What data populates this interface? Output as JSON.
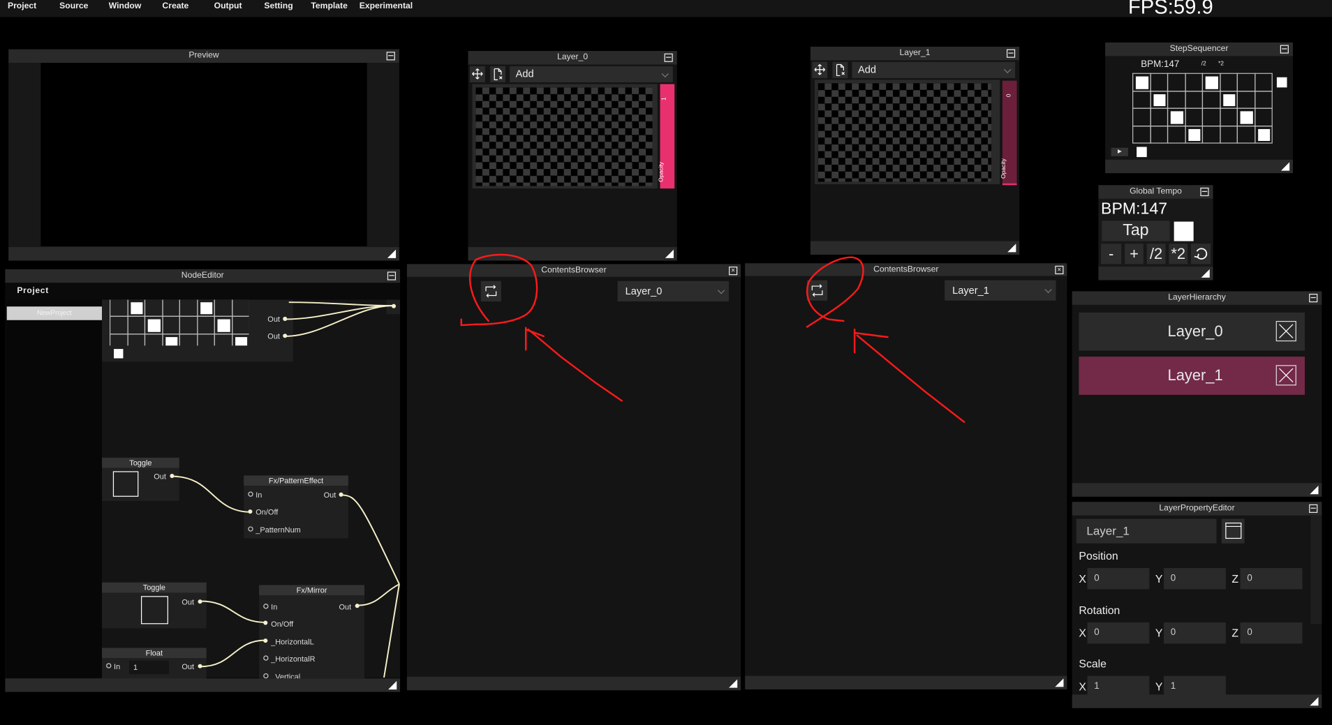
{
  "menu": [
    "Project",
    "Source",
    "Window",
    "Create",
    "Output",
    "Setting",
    "Template",
    "Experimental"
  ],
  "fps": "FPS:59.9",
  "preview": {
    "title": "Preview"
  },
  "layer_panels": [
    {
      "title": "Layer_0",
      "blend_mode": "Add",
      "opacity_label": "Opacity",
      "opacity_value": "1",
      "opacity": 1
    },
    {
      "title": "Layer_1",
      "blend_mode": "Add",
      "opacity_label": "Opacity",
      "opacity_value": "0",
      "opacity": 0
    }
  ],
  "step_sequencer": {
    "title": "StepSequencer",
    "bpm": "BPM:147",
    "half": "/2",
    "double": "*2",
    "steps": [
      [
        1,
        0,
        0,
        0,
        1,
        0,
        0,
        0
      ],
      [
        0,
        1,
        0,
        0,
        0,
        1,
        0,
        0
      ],
      [
        0,
        0,
        1,
        0,
        0,
        0,
        1,
        0
      ],
      [
        0,
        0,
        0,
        1,
        0,
        0,
        0,
        1
      ]
    ]
  },
  "global_tempo": {
    "title": "Global Tempo",
    "bpm": "BPM:147",
    "tap": "Tap",
    "minus": "-",
    "plus": "+",
    "half": "/2",
    "double": "*2"
  },
  "node_editor": {
    "title": "NodeEditor",
    "project_label": "Project",
    "project_item": "NewProject",
    "nodes": {
      "seq_outs": [
        "Out",
        "Out"
      ],
      "toggle1": {
        "title": "Toggle",
        "out": "Out"
      },
      "pattern": {
        "title": "Fx/PatternEffect",
        "in": "In",
        "out": "Out",
        "onoff": "On/Off",
        "pattern_num": "_PatternNum"
      },
      "toggle2": {
        "title": "Toggle",
        "out": "Out"
      },
      "mirror": {
        "title": "Fx/Mirror",
        "in": "In",
        "out": "Out",
        "onoff": "On/Off",
        "hl": "_HorizontalL",
        "hr": "_HorizontalR",
        "v": "Vertical"
      },
      "float": {
        "title": "Float",
        "in": "In",
        "value": "1",
        "out": "Out"
      }
    }
  },
  "contents_browsers": [
    {
      "title": "ContentsBrowser",
      "layer": "Layer_0"
    },
    {
      "title": "ContentsBrowser",
      "layer": "Layer_1"
    }
  ],
  "layer_hierarchy": {
    "title": "LayerHierarchy",
    "items": [
      {
        "label": "Layer_0",
        "selected": false
      },
      {
        "label": "Layer_1",
        "selected": true
      }
    ]
  },
  "layer_property_editor": {
    "title": "LayerPropertyEditor",
    "name": "Layer_1",
    "position": {
      "label": "Position",
      "x": "0",
      "y": "0",
      "z": "0"
    },
    "rotation": {
      "label": "Rotation",
      "x": "0",
      "y": "0",
      "z": "0"
    },
    "scale": {
      "label": "Scale",
      "x": "1",
      "y": "1"
    },
    "axes": {
      "x": "X",
      "y": "Y",
      "z": "Z"
    }
  },
  "colors": {
    "accent_pink": "#e8306f",
    "selected_layer": "#722a48",
    "wire": "#f5f0c8",
    "annotation": "#ff1a1a"
  }
}
